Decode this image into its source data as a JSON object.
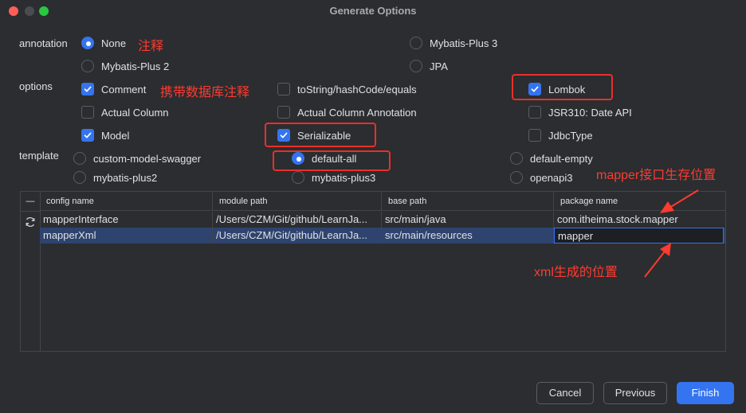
{
  "window": {
    "title": "Generate Options"
  },
  "annotation": {
    "label": "annotation",
    "options": [
      {
        "label": "None",
        "selected": true
      },
      {
        "label": "Mybatis-Plus 3",
        "selected": false
      },
      {
        "label": "Mybatis-Plus 2",
        "selected": false
      },
      {
        "label": "JPA",
        "selected": false
      }
    ]
  },
  "options": {
    "label": "options",
    "items": [
      {
        "label": "Comment",
        "checked": true
      },
      {
        "label": "toString/hashCode/equals",
        "checked": false
      },
      {
        "label": "Lombok",
        "checked": true
      },
      {
        "label": "Actual Column",
        "checked": false
      },
      {
        "label": "Actual Column Annotation",
        "checked": false
      },
      {
        "label": "JSR310: Date API",
        "checked": false
      },
      {
        "label": "Model",
        "checked": true
      },
      {
        "label": "Serializable",
        "checked": true
      },
      {
        "label": "JdbcType",
        "checked": false
      }
    ]
  },
  "template": {
    "label": "template",
    "options": [
      {
        "label": "custom-model-swagger",
        "selected": false
      },
      {
        "label": "default-all",
        "selected": true
      },
      {
        "label": "default-empty",
        "selected": false
      },
      {
        "label": "mybatis-plus2",
        "selected": false
      },
      {
        "label": "mybatis-plus3",
        "selected": false
      },
      {
        "label": "openapi3",
        "selected": false
      }
    ]
  },
  "table": {
    "gutter_header": "—",
    "columns": [
      "config name",
      "module path",
      "base path",
      "package name"
    ],
    "rows": [
      [
        "mapperInterface",
        "/Users/CZM/Git/github/LearnJa...",
        "src/main/java",
        "com.itheima.stock.mapper"
      ],
      [
        "mapperXml",
        "/Users/CZM/Git/github/LearnJa...",
        "src/main/resources",
        "mapper"
      ]
    ]
  },
  "annotations": {
    "none_note": "注释",
    "comment_note": "携带数据库注释",
    "mapper_note": "mapper接口生存位置",
    "xml_note": "xml生成的位置"
  },
  "buttons": {
    "cancel": "Cancel",
    "previous": "Previous",
    "finish": "Finish"
  },
  "colors": {
    "accent": "#3574f0",
    "annotation_red": "#e8302a",
    "background": "#2b2d30"
  }
}
